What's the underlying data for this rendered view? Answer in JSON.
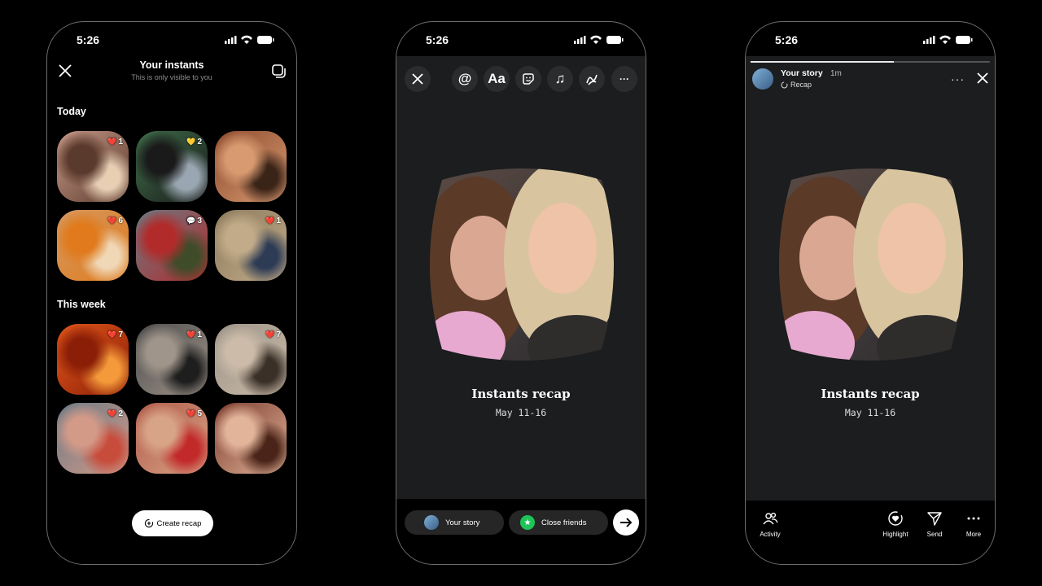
{
  "status": {
    "time": "5:26"
  },
  "instants": {
    "title": "Your instants",
    "subtitle": "This is only visible to you",
    "sections": [
      {
        "label": "Today",
        "items": [
          {
            "icon": "heart-icon",
            "glyph": "❤️",
            "count": "1",
            "colors": [
              "#c89a8a",
              "#5a3a2c",
              "#e8cfb4"
            ]
          },
          {
            "icon": "yellow-heart-icon",
            "glyph": "💛",
            "count": "2",
            "colors": [
              "#3f6e4a",
              "#1a1a1a",
              "#9aa7b2"
            ]
          },
          {
            "icon": "none",
            "glyph": "",
            "count": "",
            "colors": [
              "#8b4a2e",
              "#d89a70",
              "#3a2418"
            ]
          },
          {
            "icon": "heart-icon",
            "glyph": "❤️",
            "count": "6",
            "colors": [
              "#d49a62",
              "#e07a1c",
              "#f0d7b5"
            ]
          },
          {
            "icon": "comment-icon",
            "glyph": "💬",
            "count": "3",
            "colors": [
              "#6b7a84",
              "#b22b2b",
              "#3e4c2a"
            ]
          },
          {
            "icon": "heart-icon",
            "glyph": "❤️",
            "count": "1",
            "colors": [
              "#8b7a5c",
              "#c2ab88",
              "#2d3b55"
            ]
          }
        ]
      },
      {
        "label": "This week",
        "items": [
          {
            "icon": "heart-icon",
            "glyph": "❤️",
            "count": "7",
            "colors": [
              "#e2571a",
              "#8a1e07",
              "#f59a3a"
            ]
          },
          {
            "icon": "heart-icon",
            "glyph": "❤️",
            "count": "1",
            "colors": [
              "#4b4b4b",
              "#a0958a",
              "#1e1e1e"
            ]
          },
          {
            "icon": "heart-icon",
            "glyph": "❤️",
            "count": "7",
            "colors": [
              "#9b9388",
              "#cbbba8",
              "#3a3028"
            ]
          },
          {
            "icon": "heart-icon",
            "glyph": "❤️",
            "count": "2",
            "colors": [
              "#6a7a86",
              "#d49a88",
              "#c84c3c"
            ]
          },
          {
            "icon": "heart-icon",
            "glyph": "❤️",
            "count": "5",
            "colors": [
              "#b05a48",
              "#d8a488",
              "#c22a2a"
            ]
          },
          {
            "icon": "none",
            "glyph": "",
            "count": "",
            "colors": [
              "#7a3a2c",
              "#e2b49a",
              "#4a2418"
            ]
          }
        ]
      }
    ],
    "create_label": "Create recap"
  },
  "editor": {
    "tools": [
      {
        "icon": "mention-icon",
        "glyph": "@"
      },
      {
        "icon": "text-icon",
        "glyph": "Aa"
      },
      {
        "icon": "sticker-icon",
        "glyph": ""
      },
      {
        "icon": "music-icon",
        "glyph": "♫"
      },
      {
        "icon": "draw-icon",
        "glyph": ""
      },
      {
        "icon": "more-icon",
        "glyph": "···"
      }
    ],
    "recap_title": "Instants recap",
    "recap_date": "May 11-16",
    "share": {
      "your_story": "Your story",
      "close_friends": "Close friends"
    }
  },
  "story": {
    "name": "Your story",
    "ago": "1m",
    "tag": "Recap",
    "progress": 0.6,
    "recap_title": "Instants recap",
    "recap_date": "May 11-16",
    "actions": {
      "activity": "Activity",
      "highlight": "Highlight",
      "send": "Send",
      "more": "More"
    }
  },
  "colors": {
    "close_friends": "#1ec458",
    "accent_bg": "#1b1d1e"
  }
}
